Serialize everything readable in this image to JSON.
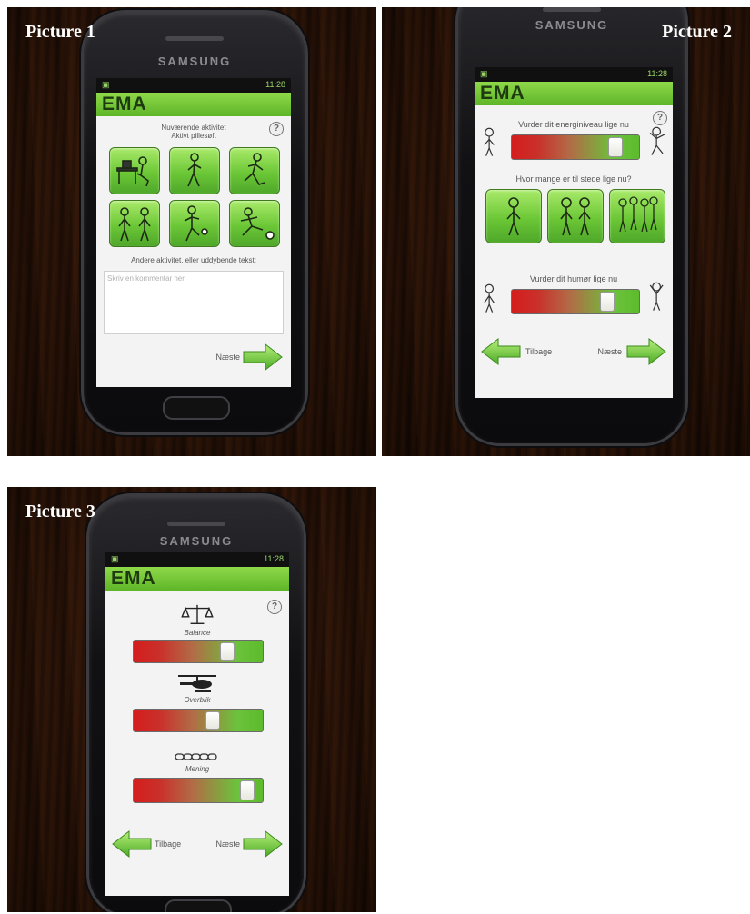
{
  "panels": [
    {
      "caption": "Picture 1",
      "brand": "SAMSUNG",
      "status_time": "11:28",
      "app_title": "EMA",
      "help_icon": "?",
      "question": "Nuværende aktivitet\nAktivt pillesøft",
      "tiles": [
        "desk-work-icon",
        "walking-icon",
        "running-icon",
        "standing-group-icon",
        "football-juggle-icon",
        "football-kick-icon"
      ],
      "other_prompt": "Andere aktivitet, eller uddybende tekst:",
      "textarea_placeholder": "Skriv en kommentar her",
      "next_label": "Næste"
    },
    {
      "caption": "Picture 2",
      "brand": "SAMSUNG",
      "status_time": "11:28",
      "app_title": "EMA",
      "help_icon": "?",
      "energy_question": "Vurder dit energiniveau lige nu",
      "energy_level": 0.85,
      "company_question": "Hvor mange er til stede lige nu?",
      "company_tiles": [
        "one-person-icon",
        "two-people-icon",
        "group-icon"
      ],
      "mood_question": "Vurder dit humør lige nu",
      "mood_level": 0.78,
      "back_label": "Tilbage",
      "next_label": "Næste"
    },
    {
      "caption": "Picture 3",
      "brand": "SAMSUNG",
      "status_time": "11:28",
      "app_title": "EMA",
      "help_icon": "?",
      "items": [
        {
          "label": "Balance",
          "icon": "scales-icon",
          "level": 0.75
        },
        {
          "label": "Overblik",
          "icon": "helicopter-icon",
          "level": 0.62
        },
        {
          "label": "Mening",
          "icon": "chain-icon",
          "level": 0.93
        }
      ],
      "back_label": "Tilbage",
      "next_label": "Næste"
    }
  ],
  "colors": {
    "accent": "#6cc736",
    "appbar": "#7ccd3d",
    "slider_low": "#d51d1d",
    "slider_high": "#5dbb2c"
  }
}
